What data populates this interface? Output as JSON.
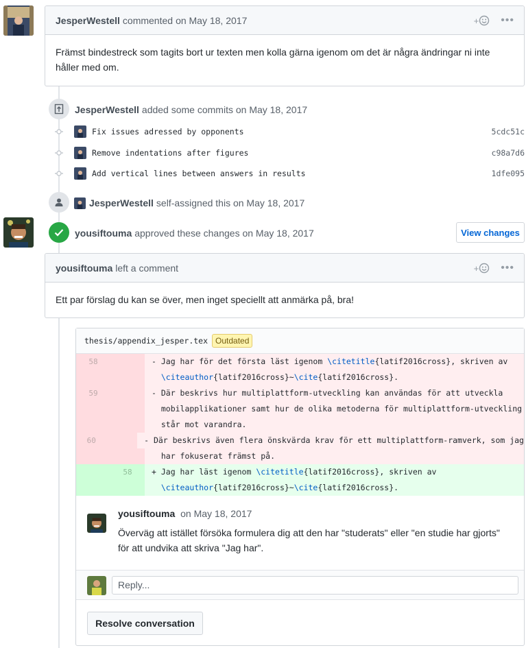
{
  "comment1": {
    "author": "JesperWestell",
    "action": "commented",
    "date": "on May 18, 2017",
    "body": "Främst bindestreck som tagits bort ur texten men kolla gärna igenom om det är några ändringar ni inte håller med om."
  },
  "commits_event": {
    "author": "JesperWestell",
    "text": "added some commits on May 18, 2017",
    "commits": [
      {
        "message": "Fix issues adressed by opponents",
        "sha": "5cdc51c"
      },
      {
        "message": "Remove indentations after figures",
        "sha": "c98a7d6"
      },
      {
        "message": "Add vertical lines between answers in results",
        "sha": "1dfe095"
      }
    ]
  },
  "assign_event": {
    "author": "JesperWestell",
    "text": "self-assigned this on May 18, 2017"
  },
  "approve_event": {
    "author": "yousiftouma",
    "text": "approved these changes on May 18, 2017",
    "button": "View changes"
  },
  "review_comment": {
    "author": "yousiftouma",
    "action": "left a comment",
    "body": "Ett par förslag du kan se över, men inget speciellt att anmärka på, bra!"
  },
  "file": {
    "path": "thesis/appendix_jesper.tex",
    "badge": "Outdated"
  },
  "diff": [
    {
      "type": "del",
      "old": "58",
      "new": "",
      "parts": [
        [
          "- Jag har för det första läst igenom ",
          ""
        ],
        [
          "\\citetitle",
          "kw"
        ],
        [
          "{latif2016cross}, skriven av",
          ""
        ]
      ]
    },
    {
      "type": "del",
      "old": "",
      "new": "",
      "parts": [
        [
          "  ",
          ""
        ],
        [
          "\\citeauthor",
          "kw"
        ],
        [
          "{latif2016cross}~",
          ""
        ],
        [
          "\\cite",
          "kw"
        ],
        [
          "{latif2016cross}.",
          ""
        ]
      ]
    },
    {
      "type": "del",
      "old": "59",
      "new": "",
      "parts": [
        [
          "- Där beskrivs hur multiplattform-utveckling kan användas för att utveckla",
          ""
        ]
      ]
    },
    {
      "type": "del",
      "old": "",
      "new": "",
      "parts": [
        [
          "  mobilapplikationer samt hur de olika metoderna för multiplattform-utveckling",
          ""
        ]
      ]
    },
    {
      "type": "del",
      "old": "",
      "new": "",
      "parts": [
        [
          "  står mot varandra.",
          ""
        ]
      ]
    },
    {
      "type": "del",
      "old": "60",
      "new": "",
      "parts": [
        [
          "- Där beskrivs även flera önskvärda krav för ett multiplattform-ramverk, som jag",
          ""
        ]
      ]
    },
    {
      "type": "del",
      "old": "",
      "new": "",
      "parts": [
        [
          "  har fokuserat främst på.",
          ""
        ]
      ]
    },
    {
      "type": "add",
      "old": "",
      "new": "58",
      "parts": [
        [
          "+ Jag har läst igenom ",
          ""
        ],
        [
          "\\citetitle",
          "kw"
        ],
        [
          "{latif2016cross}, skriven av",
          ""
        ]
      ]
    },
    {
      "type": "add",
      "old": "",
      "new": "",
      "parts": [
        [
          "  ",
          ""
        ],
        [
          "\\citeauthor",
          "kw"
        ],
        [
          "{latif2016cross}~",
          ""
        ],
        [
          "\\cite",
          "kw"
        ],
        [
          "{latif2016cross}.",
          ""
        ]
      ]
    }
  ],
  "inline_comment": {
    "author": "yousiftouma",
    "date": "on May 18, 2017",
    "body": "Överväg att istället försöka formulera dig att den har \"studerats\" eller \"en studie har gjorts\" för att undvika att skriva \"Jag har\"."
  },
  "reply": {
    "placeholder": "Reply..."
  },
  "resolve_button": "Resolve conversation",
  "icons": {
    "reaction": "smiley-plus-icon",
    "more": "kebab-horizontal-icon",
    "commit": "git-commit-icon",
    "push": "repo-push-icon",
    "person": "person-icon",
    "check": "check-icon"
  },
  "colors": {
    "approve_green": "#28a745",
    "link_blue": "#0366d6",
    "deletion_bg": "#ffeef0",
    "addition_bg": "#e6ffed",
    "outdated_bg": "#fff5b1"
  }
}
